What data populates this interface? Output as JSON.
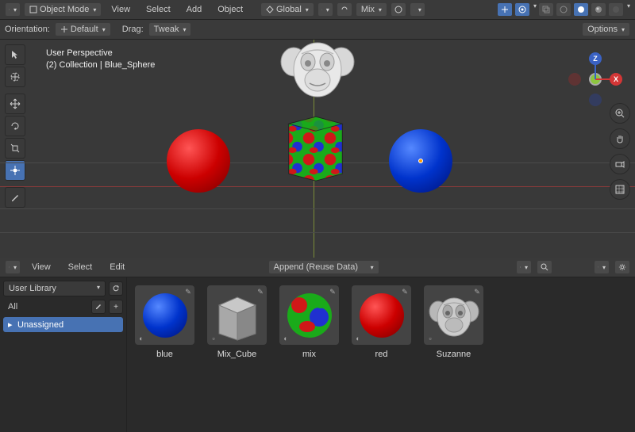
{
  "header": {
    "mode_label": "Object Mode",
    "menus": [
      "View",
      "Select",
      "Add",
      "Object"
    ],
    "orientation_label": "Global",
    "snap_mode": "Mix",
    "options_label": "Options"
  },
  "header2": {
    "orientation_title": "Orientation:",
    "orientation_value": "Default",
    "drag_title": "Drag:",
    "drag_value": "Tweak"
  },
  "viewport": {
    "line1": "User Perspective",
    "line2": "(2) Collection | Blue_Sphere"
  },
  "gizmo": {
    "x_label": "X",
    "z_label": "Z"
  },
  "asset_browser": {
    "menus": [
      "View",
      "Select",
      "Edit"
    ],
    "import_mode": "Append (Reuse Data)",
    "library": "User Library",
    "categories": [
      "All",
      "Unassigned"
    ],
    "selected_category": "Unassigned",
    "assets": [
      {
        "name": "blue",
        "type": "material-sphere",
        "color": "blue"
      },
      {
        "name": "Mix_Cube",
        "type": "cube"
      },
      {
        "name": "mix",
        "type": "mix-sphere"
      },
      {
        "name": "red",
        "type": "material-sphere",
        "color": "red"
      },
      {
        "name": "Suzanne",
        "type": "monkey"
      }
    ]
  }
}
